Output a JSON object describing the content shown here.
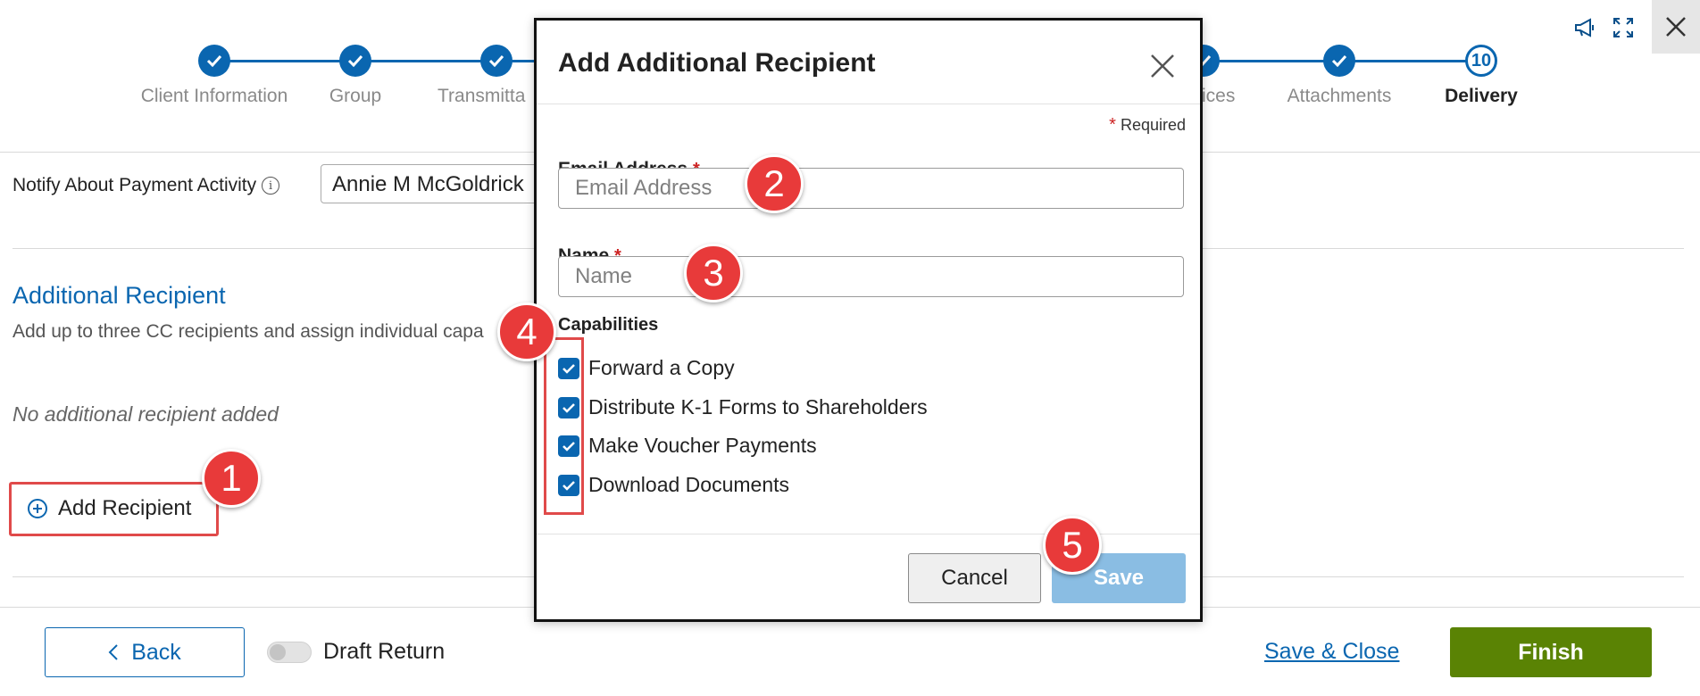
{
  "stepper": {
    "steps": [
      {
        "label": "Client Information",
        "state": "done"
      },
      {
        "label": "Group",
        "state": "done"
      },
      {
        "label": "Transmitta",
        "state": "done"
      },
      {
        "label": "ices",
        "state": "done"
      },
      {
        "label": "Attachments",
        "state": "done"
      },
      {
        "label": "Delivery",
        "state": "current",
        "number": "10"
      }
    ]
  },
  "top_icons": {
    "announce": "megaphone-icon",
    "fullscreen": "expand-icon",
    "close": "close-icon"
  },
  "notify": {
    "label": "Notify About Payment Activity",
    "info_icon": "i",
    "value": "Annie M McGoldrick"
  },
  "additional": {
    "title": "Additional Recipient",
    "description": "Add up to three CC recipients and assign individual capa",
    "empty_message": "No additional recipient added",
    "add_button": "Add Recipient"
  },
  "footer": {
    "back": "Back",
    "draft_label": "Draft Return",
    "save_close": "Save & Close",
    "finish": "Finish"
  },
  "modal": {
    "title": "Add Additional Recipient",
    "required_note": "Required",
    "required_star": "*",
    "email": {
      "label": "Email Address",
      "placeholder": "Email Address"
    },
    "name": {
      "label": "Name",
      "placeholder": "Name"
    },
    "capabilities_label": "Capabilities",
    "capabilities": [
      {
        "label": "Forward a Copy",
        "checked": true
      },
      {
        "label": "Distribute K-1 Forms to Shareholders",
        "checked": true
      },
      {
        "label": "Make Voucher Payments",
        "checked": true
      },
      {
        "label": "Download Documents",
        "checked": true
      }
    ],
    "cancel": "Cancel",
    "save": "Save"
  },
  "callouts": [
    "1",
    "2",
    "3",
    "4",
    "5"
  ],
  "colors": {
    "accent": "#0a66b0",
    "finish": "#5a8304",
    "callout": "#e83a3a",
    "save_disabled": "#8abde3"
  }
}
